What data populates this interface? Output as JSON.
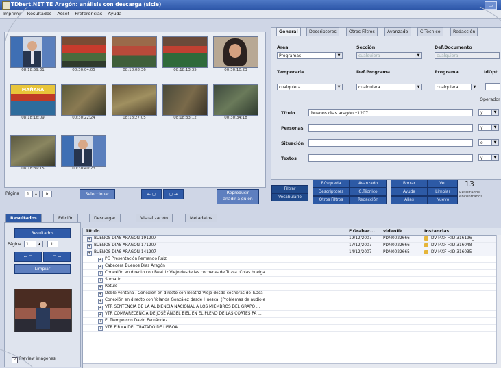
{
  "window": {
    "title": "TDbert.NET TE Aragón: análisis con descarga (sicle)",
    "restore_label": "▭"
  },
  "menu": [
    "Imprimir",
    "Resultados",
    "Asset",
    "Preferencias",
    "Ayuda"
  ],
  "thumbnails": [
    {
      "timecode": "08:18:59:31",
      "scene": "anchor"
    },
    {
      "timecode": "00:30:04:05",
      "scene": "panel"
    },
    {
      "timecode": "08:18:08:36",
      "scene": "panel2"
    },
    {
      "timecode": "08:18:13:35",
      "scene": "panel3"
    },
    {
      "timecode": "00:30:10:23",
      "scene": "woman"
    },
    {
      "timecode": "08:18:16:09",
      "scene": "logo",
      "logo_text": "MAÑANA"
    },
    {
      "timecode": "00:30:22:24",
      "scene": "crowd"
    },
    {
      "timecode": "08:18:27:05",
      "scene": "crowd2"
    },
    {
      "timecode": "08:18:33:12",
      "scene": "crowd3"
    },
    {
      "timecode": "00:30:34:18",
      "scene": "crowd4"
    },
    {
      "timecode": "08:18:39:15",
      "scene": "crowd5"
    },
    {
      "timecode": "00:30:40:23",
      "scene": "anchor2"
    }
  ],
  "pager": {
    "label": "Página",
    "value": "1",
    "go": "Ir",
    "prev": "← ◻",
    "next": "◻ →",
    "extra": "Reproducir",
    "extra2": "añadir a guión",
    "selector": "Seleccionar"
  },
  "tabs": [
    "General",
    "Descriptores",
    "Otros Filtros",
    "Avanzado",
    "C.Técnico",
    "Redacción"
  ],
  "form": {
    "area_label": "Área",
    "area_value": "Programas",
    "seccion_label": "Sección",
    "seccion_value": "cualquiera",
    "defdoc_label": "Def.Documento",
    "defdoc_value": "cualquiera",
    "temporada_label": "Temporada",
    "temporada_value": "cualquiera",
    "defprog_label": "Def.Programa",
    "defprog_value": "cualquiera",
    "programa_label": "Programa",
    "programa_value": "cualquiera",
    "idopt_label": "IdOpt",
    "operador_label": "Operador",
    "titulo_label": "Título",
    "titulo_value": "buenos días aragón *1207",
    "personas_label": "Personas",
    "situacion_label": "Situación",
    "textos_label": "Textos",
    "ops": [
      "y",
      "y",
      "o",
      "y"
    ]
  },
  "buttons": {
    "buscar": "Búsqueda",
    "avanzado": "Avanzado",
    "borrar": "Borrar",
    "ver": "Ver",
    "filtrar": "Filtrar",
    "vocabulario": "Vocabulario",
    "descriptores": "Descriptores",
    "ctecnico": "C.Técnico",
    "ayuda": "Ayuda",
    "limpiar": "Limpiar",
    "otrosfiltros": "Otros Filtros",
    "redaccion": "Redacción",
    "alias": "Alias",
    "nuevo": "Nuevo"
  },
  "count": {
    "value": "13",
    "label": "Resultados encontrados"
  },
  "lower_tabs": [
    "Resultados",
    "Edición",
    "Descargar",
    "Visualización",
    "Metadatos"
  ],
  "left": {
    "header": "Resultados",
    "page_label": "Página",
    "page_value": "1",
    "go": "Ir",
    "prev": "← ◻",
    "next": "◻ →",
    "clear": "Limpiar",
    "check_label": "Preview imágenes"
  },
  "table": {
    "headers": [
      "Título",
      "F.Grabac...",
      "videoID",
      "Instancias"
    ],
    "rows": [
      {
        "title": "BUENOS DIAS ARAGON 191207",
        "date": "19/12/2007",
        "id": "PDM0022666",
        "inst": "DV MXF <ID:316196_",
        "main": true
      },
      {
        "title": "BUENOS DIAS ARAGON 171207",
        "date": "17/12/2007",
        "id": "PDM0022666",
        "inst": "DV MXF <ID:316048_",
        "main": true
      },
      {
        "title": "BUENOS DIAS ARAGON 141207",
        "date": "14/12/2007",
        "id": "PDM0022665",
        "inst": "DV MXF <ID:316035_",
        "main": true
      },
      {
        "title": "PG Presentación Fernando Ruiz",
        "sub": true
      },
      {
        "title": "Cabecera Buenos Días Aragón",
        "sub": true
      },
      {
        "title": "Conexión en directo con Beatriz Viejo desde las cocheras de Tuzsa. Colas huelga",
        "sub": true
      },
      {
        "title": "Sumario",
        "sub": true
      },
      {
        "title": "Rótulo",
        "sub": true
      },
      {
        "title": "Doble ventana . Conexión en directo con Beatriz Viejo desde cocheras de Tuzsa",
        "sub": true
      },
      {
        "title": "Conexión en directo con Yolanda González desde Huesca. (Problemas de audio e",
        "sub": true
      },
      {
        "title": "VTR SENTENCIA DE LA AUDIENCIA NACIONAL A LOS MIEMBROS DEL GRAPO ...",
        "sub": true
      },
      {
        "title": "VTR COMPARECENCIA DE JOSÉ ÁNGEL BIEL EN EL PLENO DE LAS CORTES PA ...",
        "sub": true
      },
      {
        "title": "El Tiempo con David Fernández",
        "sub": true
      },
      {
        "title": "VTR FIRMA DEL TRATADO DE LISBOA",
        "sub": true
      }
    ]
  }
}
